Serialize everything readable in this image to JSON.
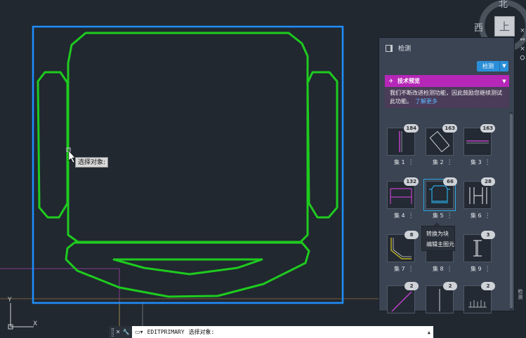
{
  "viewcube": {
    "north": "北",
    "west": "西",
    "top_face": "上",
    "strip_icons": [
      "×",
      "⇔",
      "×",
      "⛭"
    ]
  },
  "cursor_tooltip": "选择对象:",
  "ucs": {
    "x_label": "X",
    "y_label": "Y"
  },
  "palette": {
    "title": "检测",
    "detect_button": "检测",
    "preview": {
      "title": "技术预览",
      "message": "我们不断改进检测功能，因此鼓励您继续测试此功能。",
      "link": "了解更多"
    },
    "sets": [
      {
        "label": "集 1",
        "count": "184"
      },
      {
        "label": "集 2",
        "count": "163"
      },
      {
        "label": "集 3",
        "count": "163"
      },
      {
        "label": "集 4",
        "count": "132"
      },
      {
        "label": "集 5",
        "count": "66"
      },
      {
        "label": "集 6",
        "count": "28"
      },
      {
        "label": "集 7",
        "count": "8"
      },
      {
        "label": "集 8",
        "count": ""
      },
      {
        "label": "集 9",
        "count": "3"
      },
      {
        "label": "",
        "count": "2"
      },
      {
        "label": "",
        "count": "2"
      },
      {
        "label": "",
        "count": "2"
      }
    ],
    "more_glyph": "⋮",
    "context_menu": [
      "转换为块",
      "编辑主图元"
    ],
    "side_tab": "检测"
  },
  "command_line": {
    "command": "EDITPRIMARY",
    "prompt": "选择对象:"
  },
  "colors": {
    "background": "#212830",
    "selection_frame": "#1e8fff",
    "geometry": "#1ecb1e",
    "accent": "#2b8ed8",
    "preview_banner": "#b627b8"
  }
}
